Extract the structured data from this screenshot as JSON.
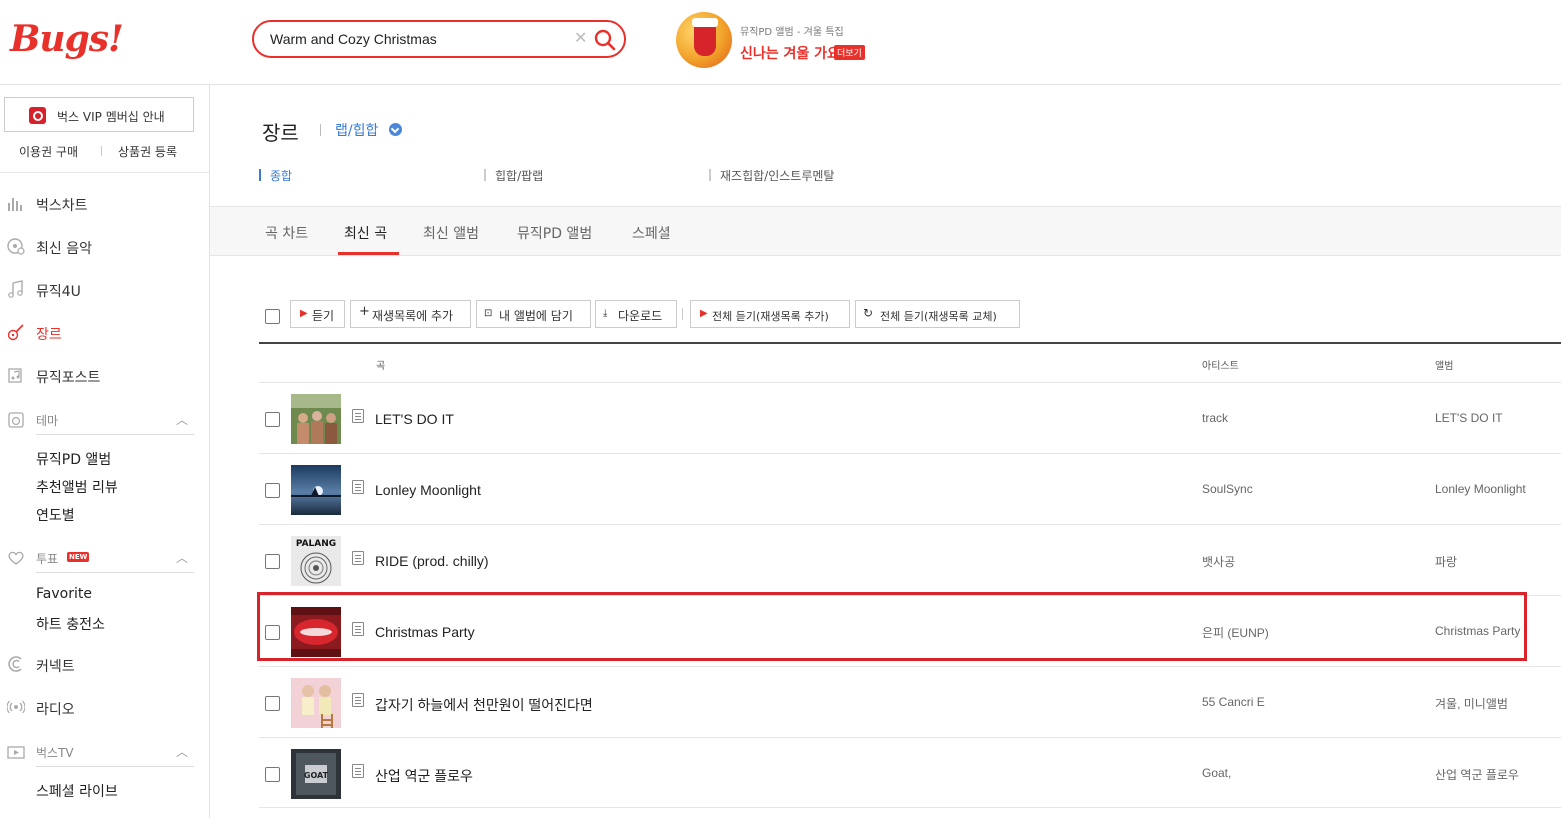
{
  "brand": {
    "logo": "Bugs!",
    "accent": "#e8312b"
  },
  "search": {
    "value": "Warm and Cozy Christmas",
    "placeholder": ""
  },
  "promo": {
    "sub": "뮤직PD 앨범 - 겨울 특집",
    "title": "신나는 겨울 가요",
    "more": "더보기"
  },
  "sidebar": {
    "vip_label": "벅스 VIP 멤버십 안내",
    "buy_ticket": "이용권 구매",
    "register_voucher": "상품권 등록",
    "nav": [
      {
        "label": "벅스차트",
        "icon": "chart-icon"
      },
      {
        "label": "최신 음악",
        "icon": "new-music-icon"
      },
      {
        "label": "뮤직4U",
        "icon": "music-note-icon"
      },
      {
        "label": "장르",
        "icon": "guitar-icon",
        "active": true
      },
      {
        "label": "뮤직포스트",
        "icon": "music-post-icon"
      }
    ],
    "theme": {
      "label": "테마",
      "items": [
        "뮤직PD 앨범",
        "추천앨범 리뷰",
        "연도별"
      ]
    },
    "vote": {
      "label": "투표",
      "badge": "NEW",
      "items": [
        "Favorite",
        "하트 충전소"
      ]
    },
    "connect": "커넥트",
    "radio": "라디오",
    "tv": {
      "label": "벅스TV",
      "items": [
        "스페셜 라이브"
      ]
    }
  },
  "main": {
    "page_title": "장르",
    "genre": "랩/힙합",
    "sub_tabs": [
      "종합",
      "힙합/팝랩",
      "재즈힙합/인스트루멘탈"
    ],
    "tabs": [
      "곡 차트",
      "최신 곡",
      "최신 앨범",
      "뮤직PD 앨범",
      "스페셜"
    ],
    "active_tab": "최신 곡",
    "toolbar": {
      "listen": "듣기",
      "add_playlist": "재생목록에 추가",
      "add_album": "내 앨범에 담기",
      "download": "다운로드",
      "play_all_add": "전체 듣기(재생목록 추가)",
      "play_all_replace": "전체 듣기(재생목록 교체)"
    },
    "columns": {
      "song": "곡",
      "artist": "아티스트",
      "album": "앨범"
    },
    "rows": [
      {
        "title": "LET'S DO IT",
        "artist": "track",
        "album": "LET'S DO IT"
      },
      {
        "title": "Lonley Moonlight",
        "artist": "SoulSync",
        "album": "Lonley Moonlight"
      },
      {
        "title": "RIDE (prod. chilly)",
        "artist": "뱃사공",
        "album": "파랑",
        "cover_text": "PALANG"
      },
      {
        "title": "Christmas Party",
        "artist": "은피 (EUNP)",
        "album": "Christmas Party",
        "highlighted": true
      },
      {
        "title": "갑자기 하늘에서 천만원이 떨어진다면",
        "artist": "55 Cancri E",
        "album": "겨울, 미니앨범"
      },
      {
        "title": "산업 역군 플로우",
        "artist": "Goat,",
        "album": "산업 역군 플로우",
        "cover_text": "GOAT"
      }
    ]
  },
  "colors": {
    "highlight_border": "#d8232a",
    "link_blue": "#3a7bd5"
  }
}
